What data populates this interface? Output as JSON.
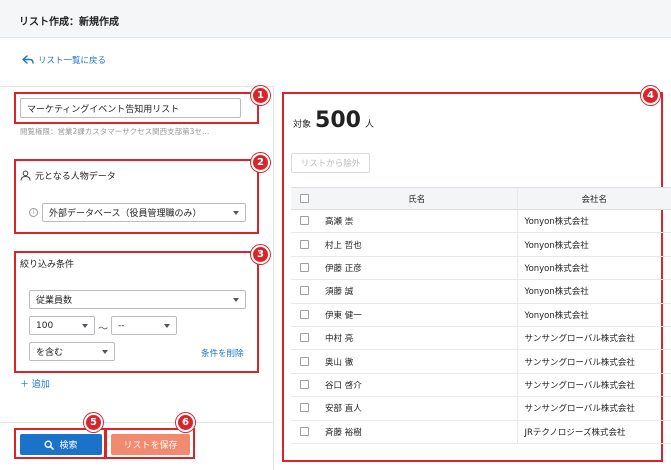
{
  "header": {
    "title": "リスト作成：新規作成"
  },
  "back_link": {
    "label": "リスト一覧に戻る"
  },
  "list_form": {
    "name_value": "マーケティングイベント告知用リスト",
    "permission_text": "閲覧権限：営業2課カスタマーサクセス関西支部第3セ…"
  },
  "source_section": {
    "title": "元となる人物データ",
    "select_value": "外部データベース（役員管理職のみ）"
  },
  "filter_section": {
    "title": "絞り込み条件",
    "field_select": "従業員数",
    "min_select": "100",
    "tilde": "〜",
    "max_select": "--",
    "operator_select": "を含む",
    "delete_label": "条件を削除"
  },
  "add_label": "＋ 追加",
  "buttons": {
    "search": "検索",
    "save": "リストを保存"
  },
  "badges": [
    "1",
    "2",
    "3",
    "4",
    "5",
    "6"
  ],
  "results": {
    "count_label": "対象",
    "count": "500",
    "count_unit": "人",
    "remove_button": "リストから除外",
    "columns": [
      "氏名",
      "会社名"
    ],
    "rows": [
      {
        "name": "高瀬 崇",
        "company": "Yonyon株式会社"
      },
      {
        "name": "村上 哲也",
        "company": "Yonyon株式会社"
      },
      {
        "name": "伊藤 正彦",
        "company": "Yonyon株式会社"
      },
      {
        "name": "須藤 誠",
        "company": "Yonyon株式会社"
      },
      {
        "name": "伊東 健一",
        "company": "Yonyon株式会社"
      },
      {
        "name": "中村 亮",
        "company": "サンサングローバル株式会社"
      },
      {
        "name": "奥山 徹",
        "company": "サンサングローバル株式会社"
      },
      {
        "name": "谷口 啓介",
        "company": "サンサングローバル株式会社"
      },
      {
        "name": "安部 直人",
        "company": "サンサングローバル株式会社"
      },
      {
        "name": "斉藤 裕樹",
        "company": "JRテクノロジーズ株式会社"
      }
    ]
  },
  "colors": {
    "accent": "#1a73c9",
    "highlight": "#d8242a",
    "save": "#f18a6f"
  }
}
